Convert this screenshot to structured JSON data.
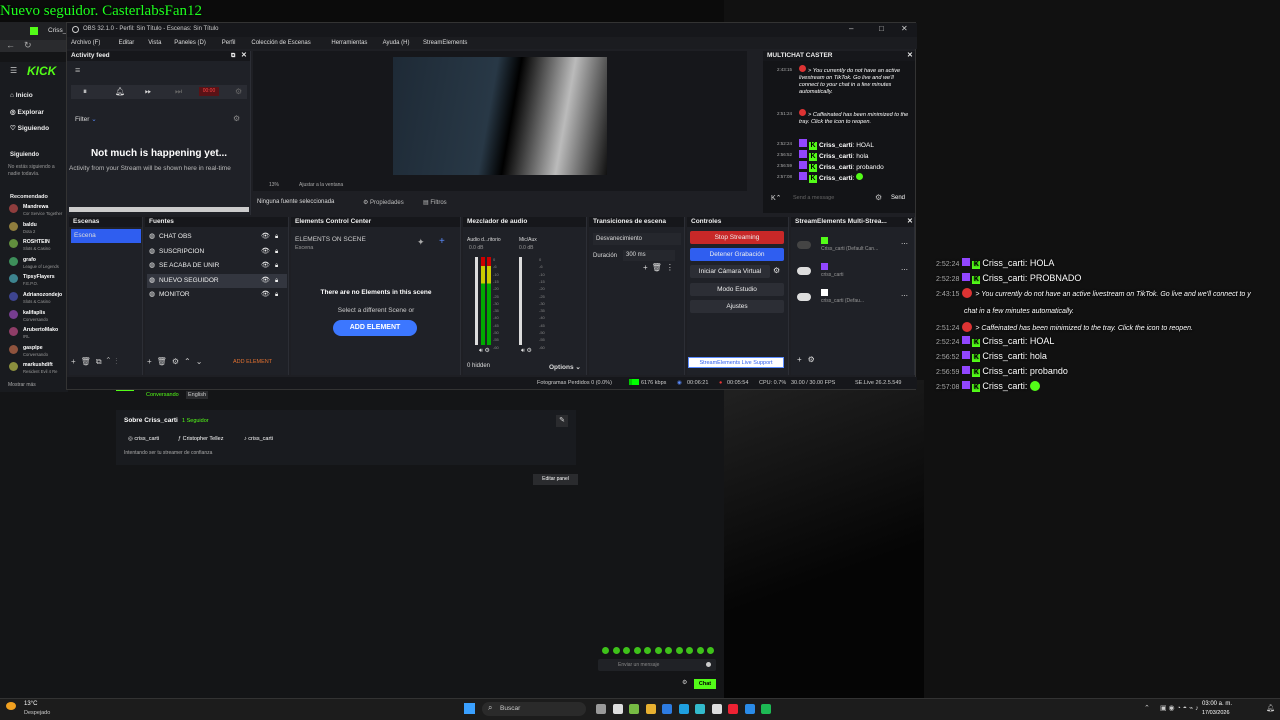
{
  "overlay_title": "Nuevo seguidor. CasterlabsFan12",
  "browser": {
    "tab_label": "Criss_c",
    "kick_nav": [
      "Inicio",
      "Explorar",
      "Siguiendo"
    ],
    "siguiendo_label": "Siguiendo",
    "no_following": "No estás siguiendo a nadie todavía.",
    "recomendado_label": "Recomendado",
    "recommended": [
      {
        "name": "Mandrewa",
        "game": "Cor Service Together"
      },
      {
        "name": "baldu",
        "game": "Dota 2"
      },
      {
        "name": "ROSHTEIN",
        "game": "Slots & Casino"
      },
      {
        "name": "grafo",
        "game": "League of Legends"
      },
      {
        "name": "TipsyFlayers",
        "game": "F.E.P.O."
      },
      {
        "name": "Adrianozondejo",
        "game": "Slots & Casino"
      },
      {
        "name": "kalifaplis",
        "game": "Conversando"
      },
      {
        "name": "ArubertoMako",
        "game": "IRL"
      },
      {
        "name": "gasplpe",
        "game": "Conversando"
      },
      {
        "name": "markushdift",
        "game": "Resident Evil 4 Re"
      }
    ],
    "mostrar_mas": "Mostrar más",
    "tags": [
      "Conversando",
      "English"
    ],
    "about_title": "Sobre Criss_carti",
    "followers": "1 Seguidor",
    "socials": [
      "criss_carti",
      "Cristopher Tellez",
      "criss_carti"
    ],
    "bio": "Intentando ser tu streamer de confianza",
    "edit_panel": "Editar panel",
    "chat_placeholder": "Enviar un mensaje",
    "chat_button": "Chat"
  },
  "obs": {
    "title": "OBS 32.1.0 - Perfil: Sin Título - Escenas: Sin Título",
    "menu": [
      "Archivo (F)",
      "Editar",
      "Vista",
      "Paneles (D)",
      "Perfil",
      "Colección de Escenas",
      "Herramientas",
      "Ayuda (H)",
      "StreamElements"
    ],
    "activity_feed": {
      "title": "Activity feed",
      "filter": "Filter",
      "rec_time": "00:00",
      "empty_title": "Not much is happening yet...",
      "empty_sub": "Activity from your Stream will be shown here in real-time"
    },
    "preview_zoom": "13%",
    "preview_fit": "Ajustar a la ventana",
    "no_source": "Ninguna fuente seleccionada",
    "properties": "Propiedades",
    "filters": "Filtros",
    "scenes": {
      "title": "Escenas",
      "items": [
        "Escena"
      ]
    },
    "sources": {
      "title": "Fuentes",
      "items": [
        "CHAT OBS",
        "SUSCRIPCION",
        "SE ACABA DE UNIR",
        "NUEVO SEGUIDOR",
        "MONITOR"
      ]
    },
    "elements": {
      "title": "Elements Control Center",
      "on_scene": "ELEMENTS ON SCENE",
      "scene": "Escena",
      "empty_title": "There are no Elements in this scene",
      "empty_sub": "Select a different Scene or",
      "add_btn": "ADD ELEMENT",
      "add_small": "ADD ELEMENT"
    },
    "mixer": {
      "title": "Mezclador de audio",
      "ch1": "Audio d...ritorio",
      "ch2": "Mic/Aux",
      "db1": "0.0 dB",
      "db2": "0.0 dB",
      "hidden": "0 hidden",
      "options": "Options",
      "ticks": [
        "0",
        "-6",
        "-10",
        "-15",
        "-20",
        "-25",
        "-30",
        "-35",
        "-40",
        "-45",
        "-50",
        "-55",
        "-60"
      ]
    },
    "transitions": {
      "title": "Transiciones de escena",
      "type": "Desvanecimiento",
      "duration_label": "Duración",
      "duration": "300 ms"
    },
    "controls": {
      "title": "Controles",
      "stop_streaming": "Stop Streaming",
      "stop_recording": "Detener Grabación",
      "virtual_cam": "Iniciar Cámara Virtual",
      "studio": "Modo Estudio",
      "settings": "Ajustes",
      "support": "StreamElements Live Support"
    },
    "multistream": {
      "title": "StreamElements Multi-Strea...",
      "rows": [
        {
          "name": "Criss_carti (Default Can...",
          "color": "#53fc18"
        },
        {
          "name": "criss_carti",
          "color": "#9146ff"
        },
        {
          "name": "criss_carti (Defau...",
          "color": "#ffffff"
        }
      ]
    },
    "status": {
      "dropped": "Fotogramas Perdidos 0 (0.0%)",
      "kbps": "6176 kbps",
      "stream_time": "00:06:21",
      "rec_time": "00:05:54",
      "cpu": "CPU: 0.7%",
      "fps": "30.00 / 30.00 FPS",
      "se_live": "SE.Live 26.2.5.549"
    },
    "multichat": {
      "title": "MULTICHAT CASTER",
      "messages": [
        {
          "time": "2:43:15",
          "type": "tiktok",
          "text": "> You currently do not have an active livestream on TikTok. Go live and we'll connect to your chat in a few minutes automatically."
        },
        {
          "time": "2:51:24",
          "type": "tiktok",
          "text": "> Caffeinated has been minimized to the tray. Click the icon to reopen."
        },
        {
          "time": "2:52:24",
          "type": "kick",
          "user": "Criss_carti",
          "text": "HOAL"
        },
        {
          "time": "2:56:52",
          "type": "kick",
          "user": "Criss_carti",
          "text": "hola"
        },
        {
          "time": "2:56:59",
          "type": "kick",
          "user": "Criss_carti",
          "text": "probando"
        },
        {
          "time": "2:57:08",
          "type": "kick",
          "user": "Criss_carti",
          "text": ""
        }
      ],
      "input_placeholder": "Send a message",
      "send": "Send"
    }
  },
  "overlay_chat": [
    {
      "time": "2:52:24",
      "user": "Criss_carti",
      "text": "HOLA",
      "badge": "kick"
    },
    {
      "time": "2:52:28",
      "user": "Criss_carti",
      "text": "PROBNADO",
      "badge": "kick"
    },
    {
      "time": "2:43:15",
      "user": "",
      "text": "> You currently do not have an active livestream on TikTok. Go live and we'll connect to y",
      "badge": "tiktok"
    },
    {
      "time": "",
      "user": "",
      "text": "chat in a few minutes automatically.",
      "badge": "none"
    },
    {
      "time": "2:51:24",
      "user": "",
      "text": "> Caffeinated has been minimized to the tray. Click the icon to reopen.",
      "badge": "tiktok"
    },
    {
      "time": "2:52:24",
      "user": "Criss_carti",
      "text": "HOAL",
      "badge": "kick"
    },
    {
      "time": "2:56:52",
      "user": "Criss_carti",
      "text": "hola",
      "badge": "kick"
    },
    {
      "time": "2:56:59",
      "user": "Criss_carti",
      "text": "probando",
      "badge": "kick"
    },
    {
      "time": "2:57:08",
      "user": "Criss_carti",
      "text": "",
      "badge": "kick"
    }
  ],
  "taskbar": {
    "temp": "13°C",
    "weather": "Despejado",
    "search": "Buscar",
    "time": "03:00 a. m.",
    "date": "17/03/2026"
  }
}
